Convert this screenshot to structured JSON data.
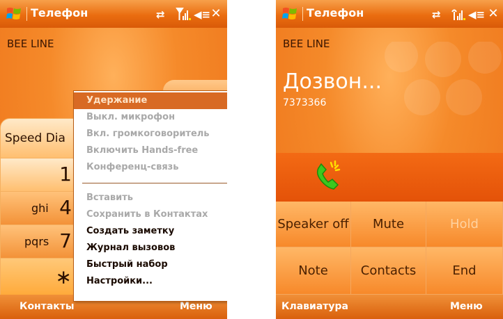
{
  "left_screen": {
    "title": "Телефон",
    "carrier": "BEE LINE",
    "speed_dial_label": "Speed Dia",
    "keypad": [
      {
        "number": "1",
        "letters": ""
      },
      {
        "number": "4",
        "letters": "ghi"
      },
      {
        "number": "7",
        "letters": "pqrs"
      },
      {
        "number": "∗",
        "letters": ""
      }
    ],
    "menu": {
      "items": [
        {
          "label": "Удержание",
          "state": "selected"
        },
        {
          "label": "Выкл. микрофон",
          "state": "disabled"
        },
        {
          "label": "Вкл. громкоговоритель",
          "state": "disabled"
        },
        {
          "label": "Включить Hands-free",
          "state": "disabled"
        },
        {
          "label": "Конференц-связь",
          "state": "disabled"
        },
        {
          "label": "Вставить",
          "state": "disabled"
        },
        {
          "label": "Сохранить в Контактах",
          "state": "disabled"
        },
        {
          "label": "Создать заметку",
          "state": "enabled"
        },
        {
          "label": "Журнал вызовов",
          "state": "enabled"
        },
        {
          "label": "Быстрый набор",
          "state": "enabled"
        },
        {
          "label": "Настройки...",
          "state": "enabled"
        }
      ]
    },
    "softkeys": {
      "left": "Контакты",
      "right": "Меню"
    }
  },
  "right_screen": {
    "title": "Телефон",
    "carrier": "BEE LINE",
    "call_status": "Дозвон...",
    "number": "7373366",
    "buttons": [
      {
        "label": "Speaker off",
        "enabled": true
      },
      {
        "label": "Mute",
        "enabled": true
      },
      {
        "label": "Hold",
        "enabled": false
      },
      {
        "label": "Note",
        "enabled": true
      },
      {
        "label": "Contacts",
        "enabled": true
      },
      {
        "label": "End",
        "enabled": true
      }
    ],
    "softkeys": {
      "left": "Клавиатура",
      "right": "Меню"
    }
  },
  "icons": {
    "start": "windows-flag-icon",
    "connection": "connection-arrows-icon",
    "signal": "signal-icon",
    "volume": "speaker-icon",
    "close": "close-icon",
    "call": "phone-handset-icon"
  },
  "colors": {
    "accent": "#ee741a",
    "title_bar": "#ea6d10",
    "menu_highlight": "#d86a24",
    "call_icon": "#3cc81e"
  }
}
